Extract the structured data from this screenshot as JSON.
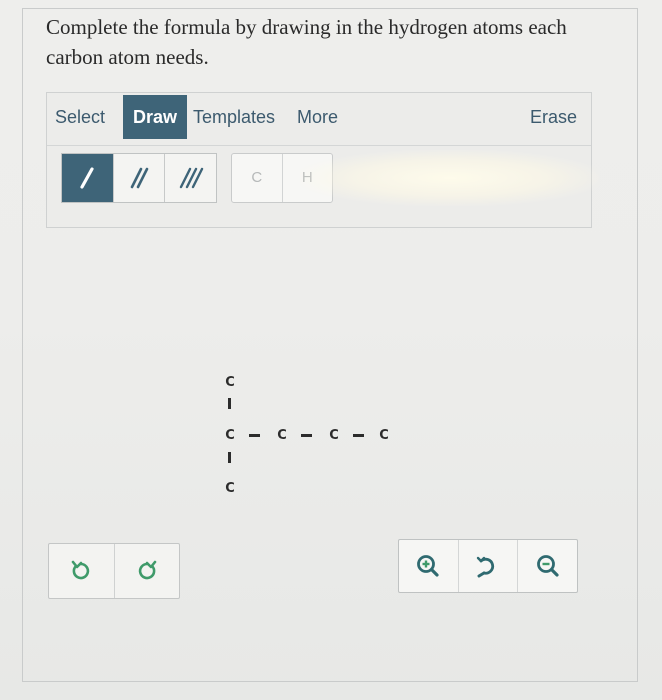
{
  "prompt": "Complete the formula by drawing in the hydrogen atoms each carbon atom needs.",
  "tabs": [
    {
      "label": "Select"
    },
    {
      "label": "Draw"
    },
    {
      "label": "Templates"
    },
    {
      "label": "More"
    }
  ],
  "active_tab": "Draw",
  "erase_label": "Erase",
  "bond_tools": [
    "single-bond",
    "double-bond",
    "triple-bond"
  ],
  "active_bond": "single-bond",
  "atom_buttons": {
    "carbon": "C",
    "hydrogen": "H"
  },
  "molecule": {
    "atoms": [
      "C",
      "C",
      "C",
      "C",
      "C",
      "C"
    ]
  },
  "history": {
    "undo_icon": "undo-icon",
    "redo_icon": "redo-icon"
  },
  "zoom": {
    "in_icon": "zoom-in-icon",
    "reset_icon": "reset-view-icon",
    "out_icon": "zoom-out-icon"
  },
  "colors": {
    "accent": "#3e6478",
    "link": "#3c5a6e",
    "green": "#3f9a6a"
  }
}
